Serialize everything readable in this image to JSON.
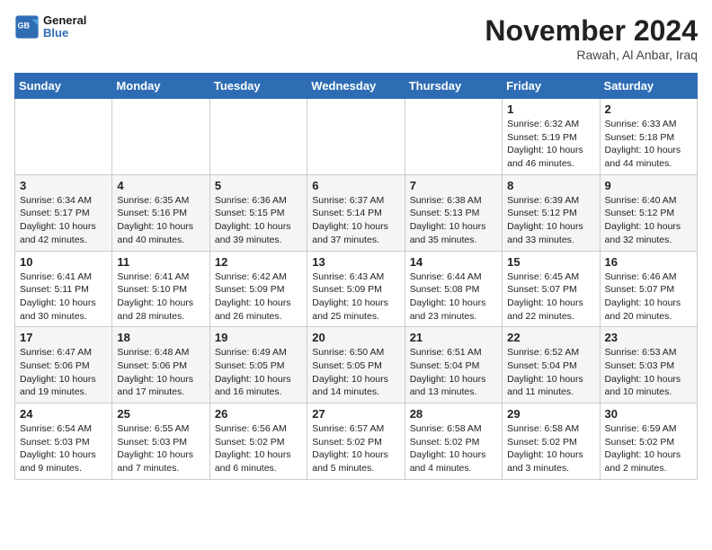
{
  "header": {
    "logo_general": "General",
    "logo_blue": "Blue",
    "month_title": "November 2024",
    "location": "Rawah, Al Anbar, Iraq"
  },
  "days_of_week": [
    "Sunday",
    "Monday",
    "Tuesday",
    "Wednesday",
    "Thursday",
    "Friday",
    "Saturday"
  ],
  "weeks": [
    [
      {
        "day": "",
        "info": ""
      },
      {
        "day": "",
        "info": ""
      },
      {
        "day": "",
        "info": ""
      },
      {
        "day": "",
        "info": ""
      },
      {
        "day": "",
        "info": ""
      },
      {
        "day": "1",
        "info": "Sunrise: 6:32 AM\nSunset: 5:19 PM\nDaylight: 10 hours and 46 minutes."
      },
      {
        "day": "2",
        "info": "Sunrise: 6:33 AM\nSunset: 5:18 PM\nDaylight: 10 hours and 44 minutes."
      }
    ],
    [
      {
        "day": "3",
        "info": "Sunrise: 6:34 AM\nSunset: 5:17 PM\nDaylight: 10 hours and 42 minutes."
      },
      {
        "day": "4",
        "info": "Sunrise: 6:35 AM\nSunset: 5:16 PM\nDaylight: 10 hours and 40 minutes."
      },
      {
        "day": "5",
        "info": "Sunrise: 6:36 AM\nSunset: 5:15 PM\nDaylight: 10 hours and 39 minutes."
      },
      {
        "day": "6",
        "info": "Sunrise: 6:37 AM\nSunset: 5:14 PM\nDaylight: 10 hours and 37 minutes."
      },
      {
        "day": "7",
        "info": "Sunrise: 6:38 AM\nSunset: 5:13 PM\nDaylight: 10 hours and 35 minutes."
      },
      {
        "day": "8",
        "info": "Sunrise: 6:39 AM\nSunset: 5:12 PM\nDaylight: 10 hours and 33 minutes."
      },
      {
        "day": "9",
        "info": "Sunrise: 6:40 AM\nSunset: 5:12 PM\nDaylight: 10 hours and 32 minutes."
      }
    ],
    [
      {
        "day": "10",
        "info": "Sunrise: 6:41 AM\nSunset: 5:11 PM\nDaylight: 10 hours and 30 minutes."
      },
      {
        "day": "11",
        "info": "Sunrise: 6:41 AM\nSunset: 5:10 PM\nDaylight: 10 hours and 28 minutes."
      },
      {
        "day": "12",
        "info": "Sunrise: 6:42 AM\nSunset: 5:09 PM\nDaylight: 10 hours and 26 minutes."
      },
      {
        "day": "13",
        "info": "Sunrise: 6:43 AM\nSunset: 5:09 PM\nDaylight: 10 hours and 25 minutes."
      },
      {
        "day": "14",
        "info": "Sunrise: 6:44 AM\nSunset: 5:08 PM\nDaylight: 10 hours and 23 minutes."
      },
      {
        "day": "15",
        "info": "Sunrise: 6:45 AM\nSunset: 5:07 PM\nDaylight: 10 hours and 22 minutes."
      },
      {
        "day": "16",
        "info": "Sunrise: 6:46 AM\nSunset: 5:07 PM\nDaylight: 10 hours and 20 minutes."
      }
    ],
    [
      {
        "day": "17",
        "info": "Sunrise: 6:47 AM\nSunset: 5:06 PM\nDaylight: 10 hours and 19 minutes."
      },
      {
        "day": "18",
        "info": "Sunrise: 6:48 AM\nSunset: 5:06 PM\nDaylight: 10 hours and 17 minutes."
      },
      {
        "day": "19",
        "info": "Sunrise: 6:49 AM\nSunset: 5:05 PM\nDaylight: 10 hours and 16 minutes."
      },
      {
        "day": "20",
        "info": "Sunrise: 6:50 AM\nSunset: 5:05 PM\nDaylight: 10 hours and 14 minutes."
      },
      {
        "day": "21",
        "info": "Sunrise: 6:51 AM\nSunset: 5:04 PM\nDaylight: 10 hours and 13 minutes."
      },
      {
        "day": "22",
        "info": "Sunrise: 6:52 AM\nSunset: 5:04 PM\nDaylight: 10 hours and 11 minutes."
      },
      {
        "day": "23",
        "info": "Sunrise: 6:53 AM\nSunset: 5:03 PM\nDaylight: 10 hours and 10 minutes."
      }
    ],
    [
      {
        "day": "24",
        "info": "Sunrise: 6:54 AM\nSunset: 5:03 PM\nDaylight: 10 hours and 9 minutes."
      },
      {
        "day": "25",
        "info": "Sunrise: 6:55 AM\nSunset: 5:03 PM\nDaylight: 10 hours and 7 minutes."
      },
      {
        "day": "26",
        "info": "Sunrise: 6:56 AM\nSunset: 5:02 PM\nDaylight: 10 hours and 6 minutes."
      },
      {
        "day": "27",
        "info": "Sunrise: 6:57 AM\nSunset: 5:02 PM\nDaylight: 10 hours and 5 minutes."
      },
      {
        "day": "28",
        "info": "Sunrise: 6:58 AM\nSunset: 5:02 PM\nDaylight: 10 hours and 4 minutes."
      },
      {
        "day": "29",
        "info": "Sunrise: 6:58 AM\nSunset: 5:02 PM\nDaylight: 10 hours and 3 minutes."
      },
      {
        "day": "30",
        "info": "Sunrise: 6:59 AM\nSunset: 5:02 PM\nDaylight: 10 hours and 2 minutes."
      }
    ]
  ]
}
